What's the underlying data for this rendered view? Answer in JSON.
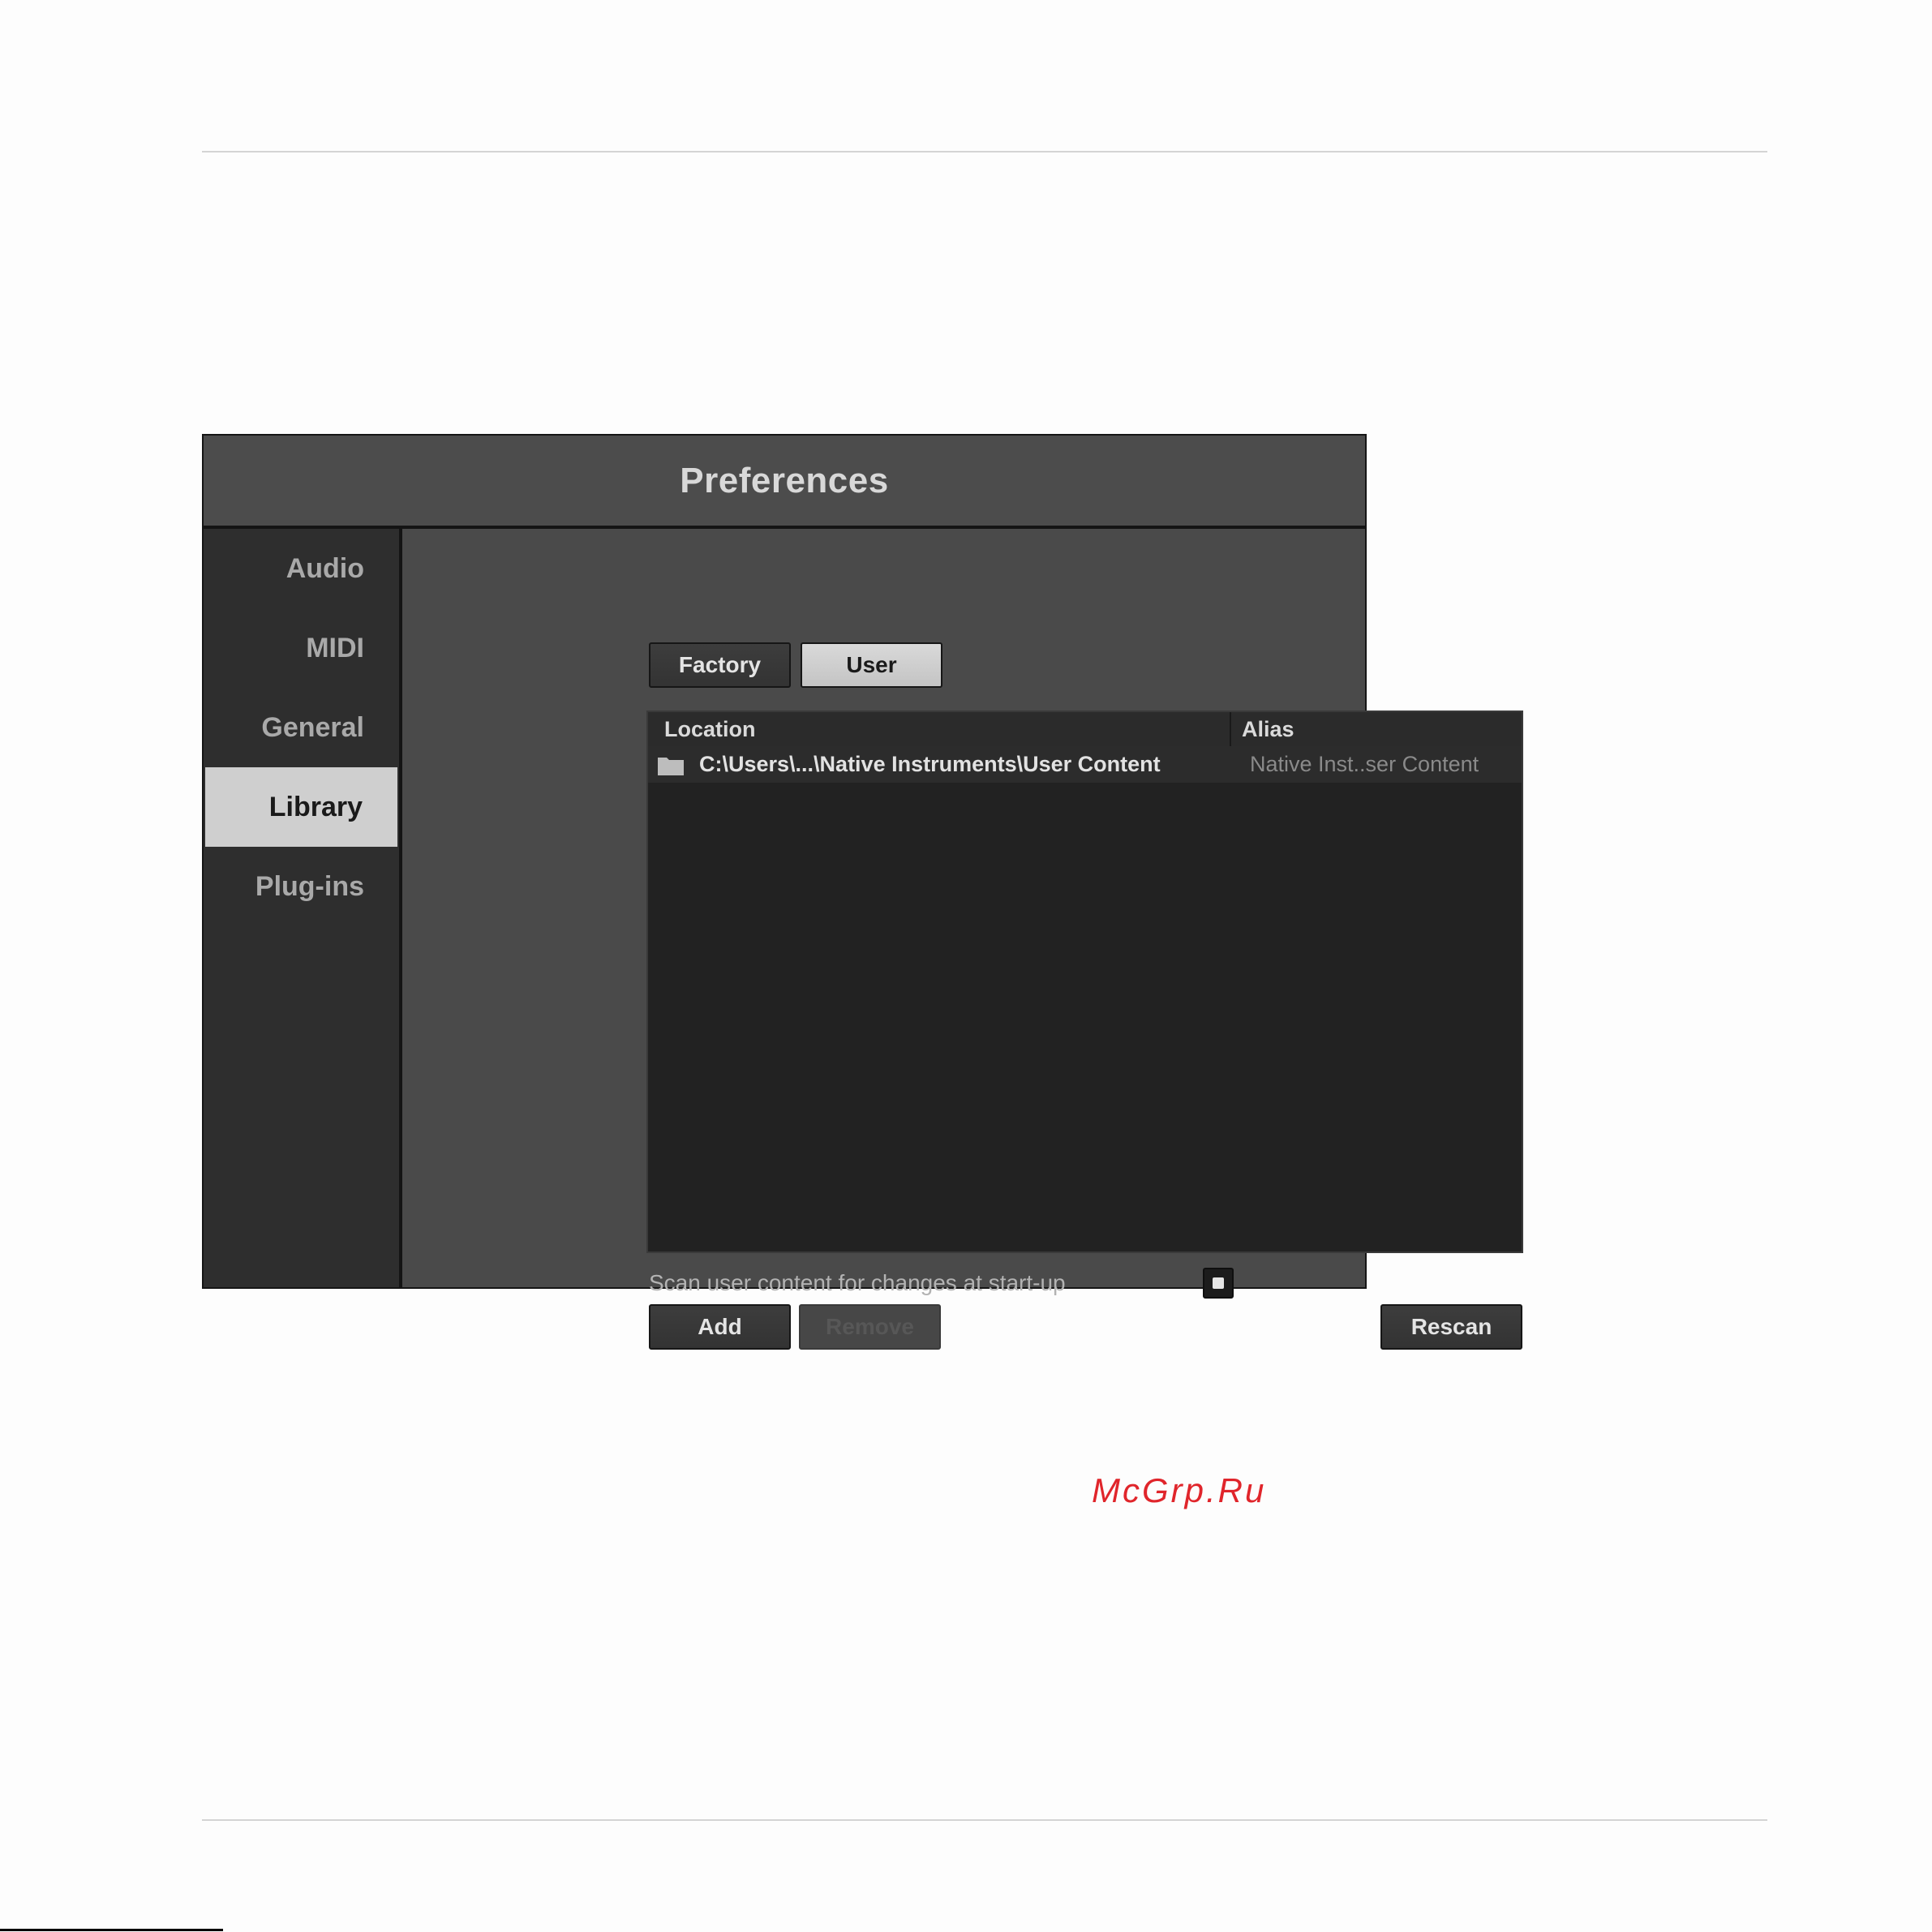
{
  "window": {
    "title": "Preferences"
  },
  "sidebar": {
    "items": [
      {
        "label": "Audio",
        "active": false
      },
      {
        "label": "MIDI",
        "active": false
      },
      {
        "label": "General",
        "active": false
      },
      {
        "label": "Library",
        "active": true
      },
      {
        "label": "Plug-ins",
        "active": false
      }
    ]
  },
  "tabs": {
    "factory": "Factory",
    "user": "User",
    "selected": "User"
  },
  "table": {
    "columns": {
      "location": "Location",
      "alias": "Alias"
    },
    "rows": [
      {
        "icon": "folder-icon",
        "location": "C:\\Users\\...\\Native Instruments\\User Content",
        "alias": "Native Inst..ser Content"
      }
    ]
  },
  "watermark": "McGrp.Ru",
  "options": {
    "scan_label": "Scan user content for changes at start-up",
    "scan_checked": true
  },
  "actions": {
    "add": "Add",
    "remove": "Remove",
    "remove_enabled": false,
    "rescan": "Rescan"
  }
}
